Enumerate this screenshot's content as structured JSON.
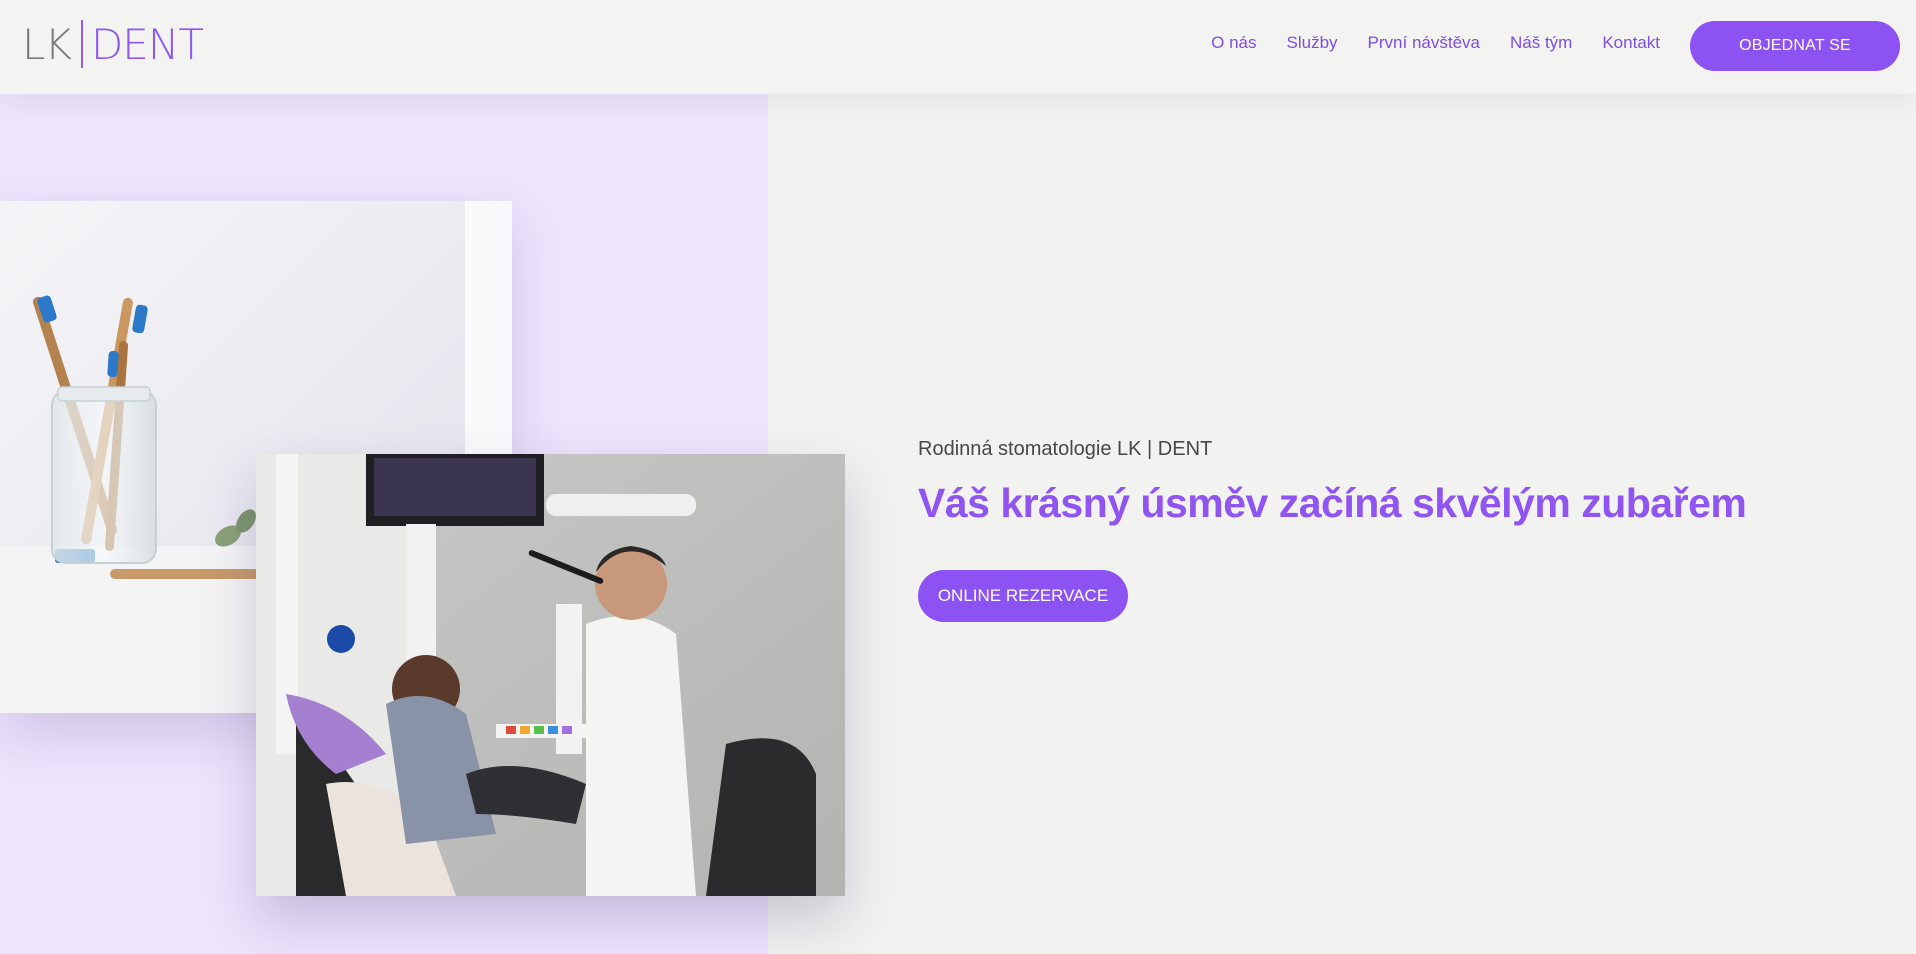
{
  "header": {
    "logo": {
      "left": "LK",
      "right": "DENT"
    },
    "nav": [
      {
        "label": "O nás"
      },
      {
        "label": "Služby"
      },
      {
        "label": "První návštěva"
      },
      {
        "label": "Náš tým"
      },
      {
        "label": "Kontakt"
      }
    ],
    "cta_label": "OBJEDNAT SE"
  },
  "hero": {
    "subtitle": "Rodinná stomatologie LK | DENT",
    "title": "Váš krásný úsměv začíná skvělým zubařem",
    "cta_label": "ONLINE REZERVACE"
  },
  "colors": {
    "accent": "#8c52f2",
    "accent_text": "#9054f0",
    "lavender_bg": "#ede4fd",
    "page_bg": "#f2f2f0"
  }
}
